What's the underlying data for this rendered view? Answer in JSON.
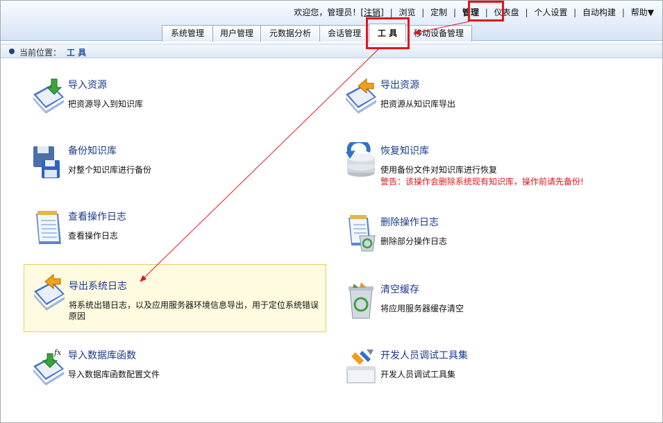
{
  "topnav": {
    "welcome": "欢迎您，管理员！[",
    "logout": "注销",
    "welcome_close": "]",
    "links": [
      "浏览",
      "定制",
      "管理",
      "仪表盘",
      "个人设置",
      "自动构建",
      "帮助▼"
    ]
  },
  "tabs": [
    "系统管理",
    "用户管理",
    "元数据分析",
    "会话管理",
    "工 具",
    "移动设备管理"
  ],
  "breadcrumb": {
    "label": "当前位置：",
    "current": "工 具"
  },
  "tools": [
    {
      "title": "导入资源",
      "desc": "把资源导入到知识库"
    },
    {
      "title": "导出资源",
      "desc": "把资源从知识库导出"
    },
    {
      "title": "备份知识库",
      "desc": "对整个知识库进行备份"
    },
    {
      "title": "恢复知识库",
      "desc": "使用备份文件对知识库进行恢复",
      "warning": "警告：该操作会删除系统现有知识库，操作前请先备份!"
    },
    {
      "title": "查看操作日志",
      "desc": "查看操作日志"
    },
    {
      "title": "删除操作日志",
      "desc": "删除部分操作日志"
    },
    {
      "title": "导出系统日志",
      "desc": "将系统出错日志，以及应用服务器环境信息导出，用于定位系统错误原因"
    },
    {
      "title": "清空缓存",
      "desc": "将应用服务器缓存清空"
    },
    {
      "title": "导入数据库函数",
      "desc": "导入数据库函数配置文件"
    },
    {
      "title": "开发人员调试工具集",
      "desc": "开发人员调试工具集"
    }
  ],
  "colors": {
    "accent": "#1a3b8a",
    "warning": "#e1141b",
    "highlight_bg": "#fffbe0",
    "annotation": "#e3141b"
  }
}
